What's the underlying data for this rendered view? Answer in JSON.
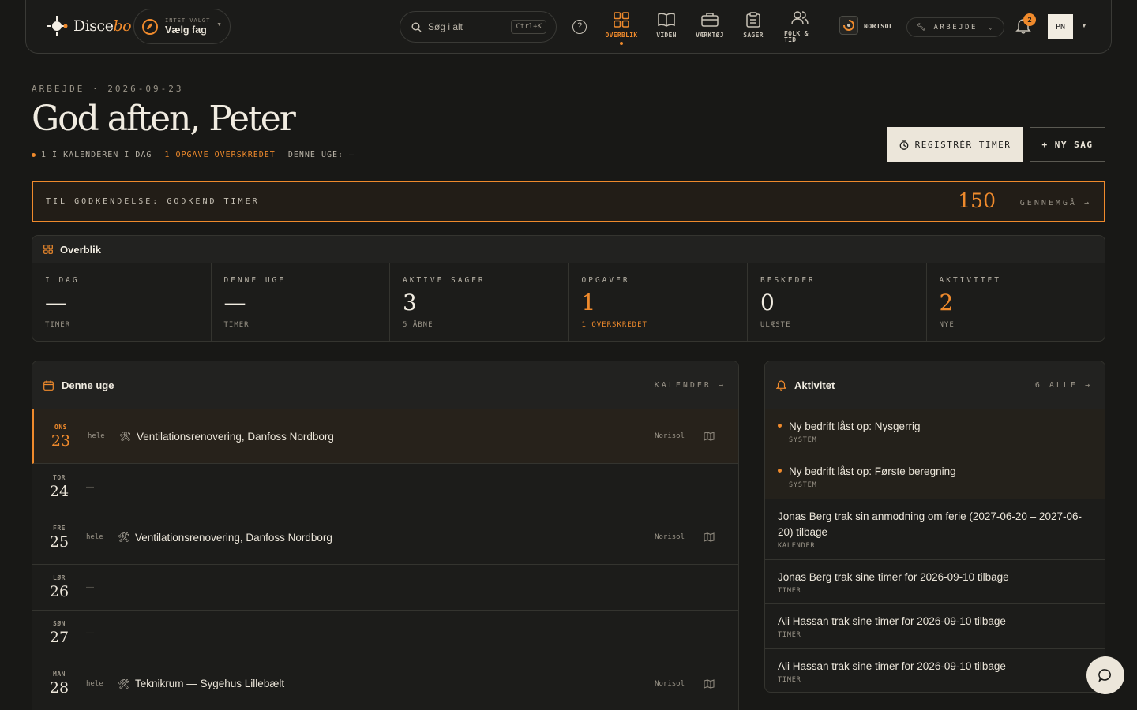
{
  "topbar": {
    "logo_text_main": "Disce",
    "logo_text_accent": "bo",
    "subject_small": "INTET VALGT",
    "subject_label": "Vælg fag",
    "search_placeholder": "Søg i alt",
    "search_shortcut": "Ctrl+K",
    "help_label": "?",
    "nav": [
      {
        "label": "OVERBLIK",
        "icon": "grid-icon",
        "active": true
      },
      {
        "label": "VIDEN",
        "icon": "book-icon",
        "active": false
      },
      {
        "label": "VÆRKTØJ",
        "icon": "briefcase-icon",
        "active": false
      },
      {
        "label": "SAGER",
        "icon": "clipboard-icon",
        "active": false
      },
      {
        "label": "FOLK & TID",
        "icon": "people-icon",
        "active": false
      }
    ],
    "org_name": "NORISOL",
    "mode_label": "ARBEJDE",
    "notification_count": "2",
    "avatar_initials": "PN"
  },
  "header": {
    "eyebrow": "ARBEJDE · 2026-09-23",
    "greeting": "God aften, Peter",
    "summary": {
      "calendar": "1 I KALENDEREN I DAG",
      "overdue": "1 OPGAVE OVERSKREDET",
      "week": "DENNE UGE: —"
    },
    "register_label": "REGISTRÉR TIMER",
    "new_case_label": "+ NY SAG"
  },
  "approval": {
    "label": "TIL GODKENDELSE: GODKEND TIMER",
    "count": "150",
    "action": "GENNEMGÅ →"
  },
  "overview": {
    "title": "Overblik",
    "stats": [
      {
        "key": "I DAG",
        "value": "—",
        "sub": "TIMER"
      },
      {
        "key": "DENNE UGE",
        "value": "—",
        "sub": "TIMER"
      },
      {
        "key": "AKTIVE SAGER",
        "value": "3",
        "sub": "5 ÅBNE"
      },
      {
        "key": "OPGAVER",
        "value": "1",
        "sub": "1 OVERSKREDET"
      },
      {
        "key": "BESKEDER",
        "value": "0",
        "sub": "ULÆSTE"
      },
      {
        "key": "AKTIVITET",
        "value": "2",
        "sub": "NYE"
      }
    ]
  },
  "week": {
    "title": "Denne uge",
    "calendar_link": "KALENDER →",
    "days": [
      {
        "dn": "ONS",
        "dd": "23",
        "today": true,
        "hele": "hele",
        "task": "Ventilationsrenovering, Danfoss Nordborg",
        "org": "Norisol"
      },
      {
        "dn": "TOR",
        "dd": "24",
        "today": false,
        "dash": "—"
      },
      {
        "dn": "FRE",
        "dd": "25",
        "today": false,
        "hele": "hele",
        "task": "Ventilationsrenovering, Danfoss Nordborg",
        "org": "Norisol"
      },
      {
        "dn": "LØR",
        "dd": "26",
        "today": false,
        "dash": "—"
      },
      {
        "dn": "SØN",
        "dd": "27",
        "today": false,
        "dash": "—"
      },
      {
        "dn": "MAN",
        "dd": "28",
        "today": false,
        "hele": "hele",
        "task": "Teknikrum — Sygehus Lillebælt",
        "org": "Norisol"
      }
    ]
  },
  "activity": {
    "title": "Aktivitet",
    "all_link": "6 ALLE →",
    "items": [
      {
        "text": "Ny bedrift låst op: Nysgerrig",
        "sub": "SYSTEM",
        "new": true
      },
      {
        "text": "Ny bedrift låst op: Første beregning",
        "sub": "SYSTEM",
        "new": true
      },
      {
        "text": "Jonas Berg trak sin anmodning om ferie (2027-06-20 – 2027-06-20) tilbage",
        "sub": "KALENDER",
        "new": false
      },
      {
        "text": "Jonas Berg trak sine timer for 2026-09-10 tilbage",
        "sub": "TIMER",
        "new": false
      },
      {
        "text": "Ali Hassan trak sine timer for 2026-09-10 tilbage",
        "sub": "TIMER",
        "new": false
      },
      {
        "text": "Ali Hassan trak sine timer for 2026-09-10 tilbage",
        "sub": "TIMER",
        "new": false
      }
    ]
  },
  "colors": {
    "accent": "#ef8a2c",
    "background": "#181816"
  }
}
